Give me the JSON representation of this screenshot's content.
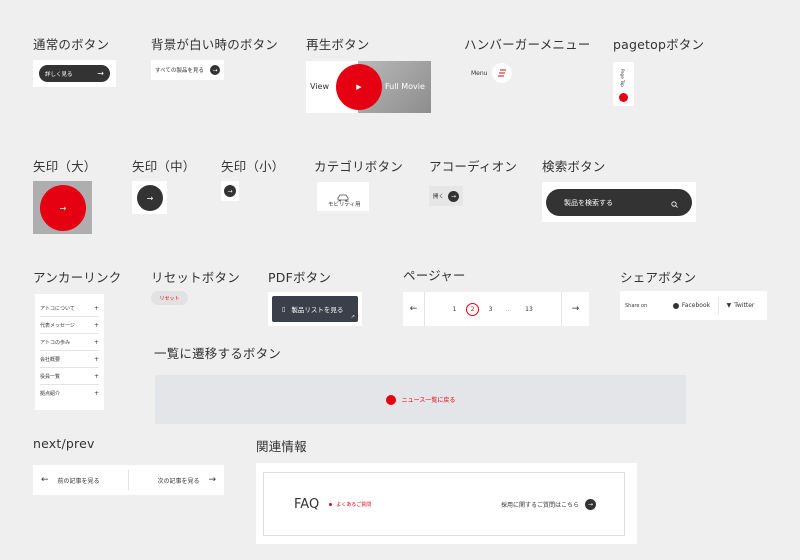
{
  "sections": {
    "normal_button": "通常のボタン",
    "white_bg_button": "背景が白い時のボタン",
    "play_button": "再生ボタン",
    "hamburger": "ハンバーガーメニュー",
    "pagetop": "pagetopボタン",
    "arrow_large": "矢印（大）",
    "arrow_medium": "矢印（中）",
    "arrow_small": "矢印（小）",
    "category": "カテゴリボタン",
    "accordion": "アコーディオン",
    "search": "検索ボタン",
    "anchor": "アンカーリンク",
    "reset": "リセットボタン",
    "pdf": "PDFボタン",
    "pager": "ページャー",
    "share": "シェアボタン",
    "list_transition": "一覧に遷移するボタン",
    "next_prev": "next/prev",
    "related": "関連情報"
  },
  "normal_button": {
    "label": "詳しく見る"
  },
  "white_bg_button": {
    "label": "すべての製品を見る"
  },
  "play_button": {
    "left": "View",
    "right": "Full Movie"
  },
  "hamburger": {
    "label": "Menu"
  },
  "pagetop": {
    "label": "Page Top"
  },
  "category": {
    "label": "モビリティ用"
  },
  "accordion": {
    "label": "開く"
  },
  "search": {
    "label": "製品を検索する"
  },
  "anchor": {
    "items": [
      "アトコについて",
      "代表メッセージ",
      "アトコの歩み",
      "会社概要",
      "役員一覧",
      "拠点紹介"
    ]
  },
  "reset": {
    "label": "リセット"
  },
  "pdf": {
    "label": "製品リストを見る"
  },
  "pager": {
    "pages": [
      "1",
      "2",
      "3",
      "…",
      "13"
    ],
    "current": "2"
  },
  "share": {
    "label": "Share on",
    "facebook": "Facebook",
    "twitter": "Twitter"
  },
  "list_transition": {
    "label": "ニュース一覧に戻る"
  },
  "next_prev": {
    "prev": "前の記事を見る",
    "next": "次の記事を見る"
  },
  "related": {
    "faq": "FAQ",
    "faq_sub": "よくあるご質問",
    "recruit": "採用に関するご質問はこちら"
  },
  "colors": {
    "accent": "#e50012",
    "dark": "#333333",
    "bg": "#efefef"
  }
}
